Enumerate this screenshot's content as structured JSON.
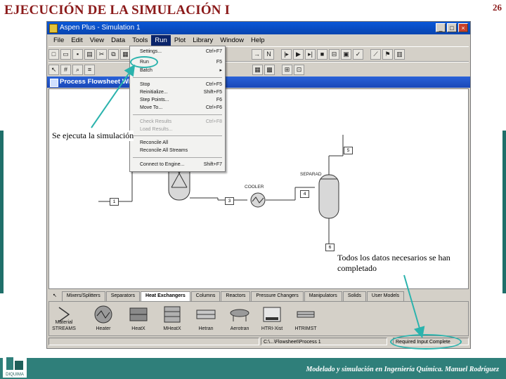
{
  "slide": {
    "title": "EJECUCIÓN DE LA SIMULACIÓN I",
    "page_number": "26",
    "footer": "Modelado y simulación en Ingeniería Química. Manuel Rodríguez",
    "logo_text": "DIQUIMA",
    "accent_color": "#2f7f7a",
    "title_color": "#8b1a1a"
  },
  "app": {
    "title": "Aspen Plus - Simulation 1",
    "window_buttons": [
      "_",
      "□",
      "×"
    ],
    "menu": [
      "File",
      "Edit",
      "View",
      "Data",
      "Tools",
      "Run",
      "Plot",
      "Library",
      "Window",
      "Help"
    ],
    "active_menu_index": 5,
    "mdi_title": "Process Flowsheet Window"
  },
  "run_menu": {
    "items": [
      {
        "label": "Settings...",
        "shortcut": "Ctrl+F7",
        "disabled": false
      },
      {
        "label": "Run",
        "shortcut": "F5",
        "disabled": false
      },
      {
        "label": "Batch",
        "shortcut": "▸",
        "disabled": false
      },
      {
        "label": "Stop",
        "shortcut": "Ctrl+F5",
        "disabled": false
      },
      {
        "label": "Reinitialize...",
        "shortcut": "Shift+F5",
        "disabled": false
      },
      {
        "label": "Step Points...",
        "shortcut": "F6",
        "disabled": false
      },
      {
        "label": "Move To...",
        "shortcut": "Ctrl+F6",
        "disabled": false
      },
      {
        "label": "Check Results",
        "shortcut": "Ctrl+F8",
        "disabled": true
      },
      {
        "label": "Load Results...",
        "shortcut": "",
        "disabled": true
      },
      {
        "label": "Reconcile All",
        "shortcut": "",
        "disabled": false
      },
      {
        "label": "Reconcile All Streams",
        "shortcut": "",
        "disabled": false
      },
      {
        "label": "Connect to Engine...",
        "shortcut": "Shift+F7",
        "disabled": false
      }
    ]
  },
  "flowsheet": {
    "units": [
      "COOLER",
      "SEPARAD"
    ],
    "streams": [
      "1",
      "2",
      "3",
      "4",
      "5",
      "6"
    ]
  },
  "palette": {
    "tabs": [
      "Mixers/Splitters",
      "Separators",
      "Heat Exchangers",
      "Columns",
      "Reactors",
      "Pressure Changers",
      "Manipulators",
      "Solids",
      "User Models"
    ],
    "active_tab_index": 2,
    "items": [
      "STREAMS",
      "Heater",
      "HeatX",
      "MHeatX",
      "Hetran",
      "Aerotran",
      "HTRI-Xist",
      "HTRIMST"
    ],
    "material_label": "Material"
  },
  "status": {
    "path": "C:\\...\\Flowsheet\\Process 1",
    "message": "Required Input Complete"
  },
  "callouts": {
    "run": "Se ejecuta la simulación",
    "complete": "Todos los datos necesarios se han completado"
  }
}
